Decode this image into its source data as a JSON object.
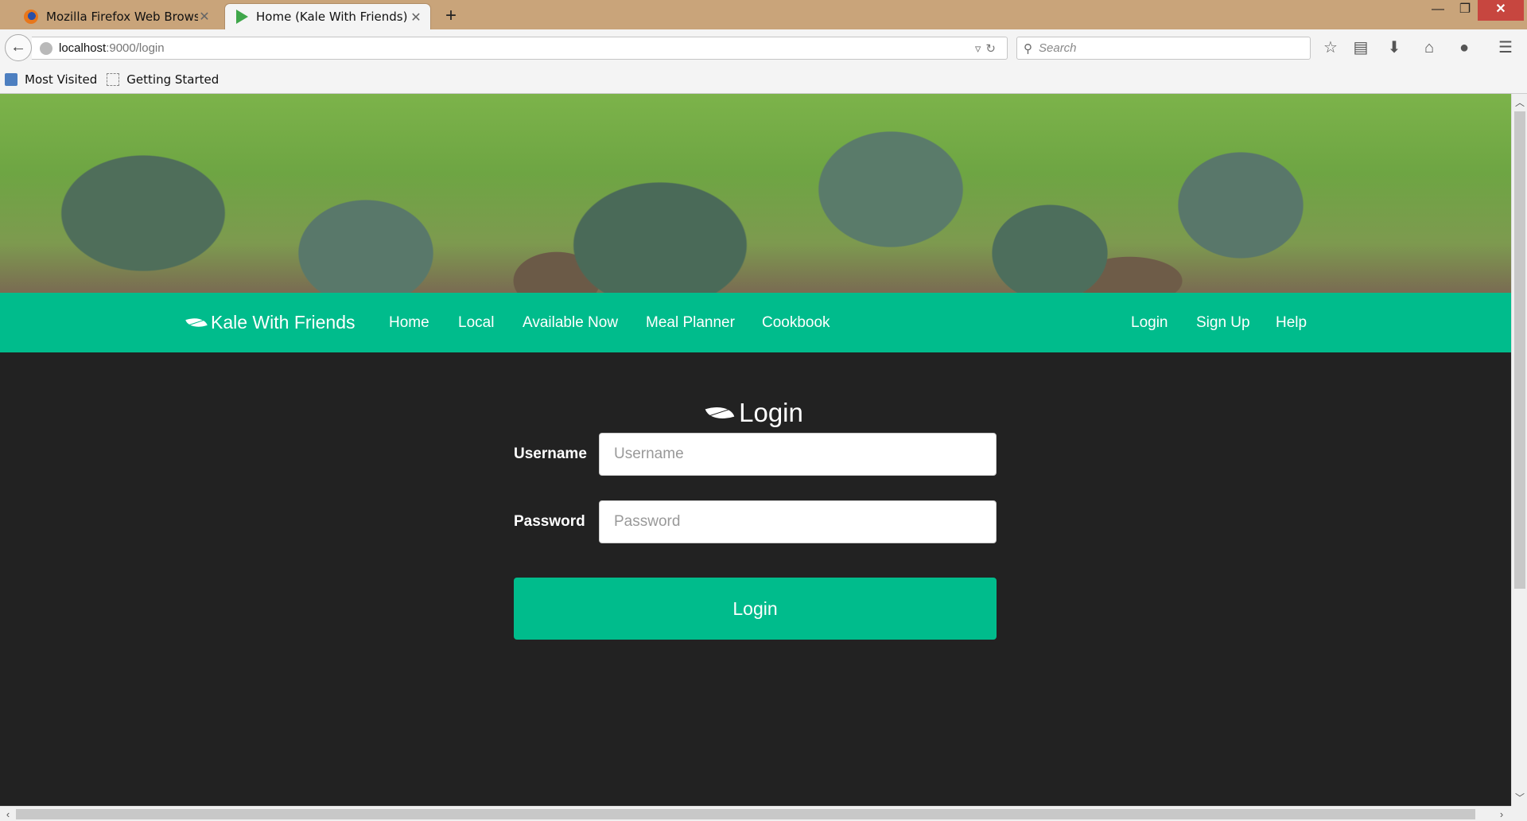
{
  "browser": {
    "tabs": [
      {
        "title": "Mozilla Firefox Web Brows...",
        "icon": "firefox-icon",
        "active": false
      },
      {
        "title": "Home (Kale With Friends)",
        "icon": "play-icon",
        "active": true
      }
    ],
    "new_tab": "+",
    "close_glyph": "✕",
    "url_host": "localhost",
    "url_path": ":9000/login",
    "search_placeholder": "Search",
    "bookmarks": [
      "Most Visited",
      "Getting Started"
    ]
  },
  "site": {
    "brand": "Kale With Friends",
    "nav_left": [
      "Home",
      "Local",
      "Available Now",
      "Meal Planner",
      "Cookbook"
    ],
    "nav_right": [
      "Login",
      "Sign Up",
      "Help"
    ],
    "accent": "#00bc8c",
    "background": "#222222"
  },
  "login": {
    "title": "Login",
    "username_label": "Username",
    "username_placeholder": "Username",
    "password_label": "Password",
    "password_placeholder": "Password",
    "submit_label": "Login"
  }
}
